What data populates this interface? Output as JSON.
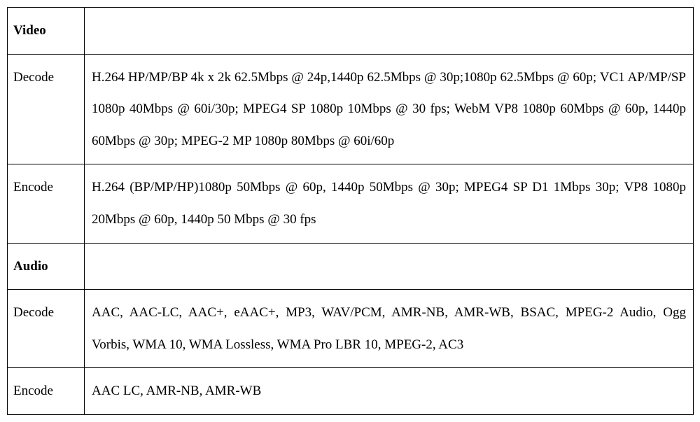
{
  "rows": [
    {
      "label": "Video",
      "labelBold": true,
      "content": ""
    },
    {
      "label": "Decode",
      "labelBold": false,
      "content": "H.264 HP/MP/BP 4k x 2k 62.5Mbps @ 24p,1440p 62.5Mbps @ 30p;1080p 62.5Mbps @ 60p; VC1 AP/MP/SP 1080p 40Mbps @ 60i/30p; MPEG4 SP 1080p 10Mbps @ 30 fps; WebM VP8 1080p 60Mbps @ 60p, 1440p 60Mbps @ 30p; MPEG-2 MP 1080p 80Mbps @ 60i/60p"
    },
    {
      "label": "Encode",
      "labelBold": false,
      "content": "H.264 (BP/MP/HP)1080p 50Mbps @ 60p, 1440p 50Mbps @ 30p; MPEG4 SP D1 1Mbps 30p; VP8 1080p 20Mbps @ 60p, 1440p 50 Mbps @ 30 fps"
    },
    {
      "label": "Audio",
      "labelBold": true,
      "content": ""
    },
    {
      "label": "Decode",
      "labelBold": false,
      "content": "AAC, AAC-LC, AAC+, eAAC+, MP3, WAV/PCM, AMR-NB, AMR-WB, BSAC, MPEG-2 Audio, Ogg Vorbis, WMA 10, WMA Lossless, WMA Pro LBR 10, MPEG-2, AC3"
    },
    {
      "label": "Encode",
      "labelBold": false,
      "content": "AAC LC, AMR-NB, AMR-WB"
    }
  ]
}
